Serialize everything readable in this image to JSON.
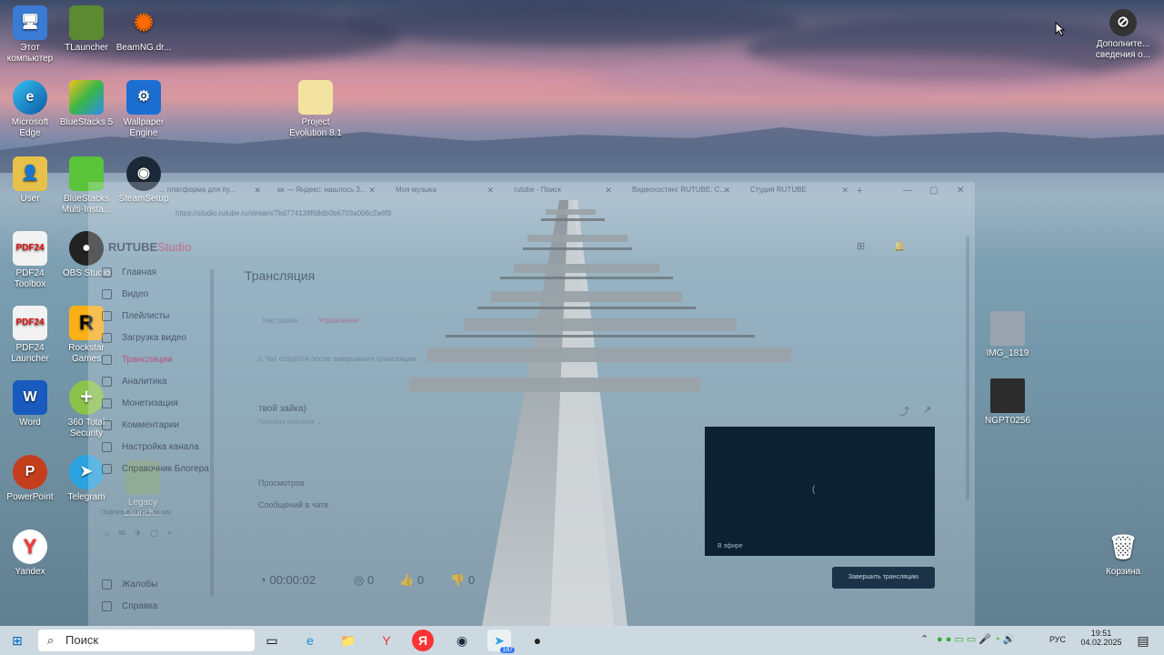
{
  "desktop": {
    "icons": [
      {
        "label": "Этот компьютер"
      },
      {
        "label": "TLauncher"
      },
      {
        "label": "BeamNG.dr..."
      },
      {
        "label": "Microsoft Edge"
      },
      {
        "label": "BlueStacks 5"
      },
      {
        "label": "Wallpaper Engine"
      },
      {
        "label": "Project Evolution 8.1"
      },
      {
        "label": "User"
      },
      {
        "label": "BlueStacks Multi-Insta..."
      },
      {
        "label": "SteamSetup"
      },
      {
        "label": "PDF24 Toolbox"
      },
      {
        "label": "OBS Studio"
      },
      {
        "label": "PDF24 Launcher"
      },
      {
        "label": "Rockstar Games"
      },
      {
        "label": "Word"
      },
      {
        "label": "360 Total Security"
      },
      {
        "label": "PowerPoint"
      },
      {
        "label": "Telegram"
      },
      {
        "label": "Legacy Launch..."
      },
      {
        "label": "Yandex"
      },
      {
        "label": "IMG_1819"
      },
      {
        "label": "NGPT0256"
      },
      {
        "label": "Корзина"
      },
      {
        "label": "Дополните... сведения о..."
      }
    ]
  },
  "browser": {
    "tabs": [
      {
        "label": "... платформа для пу..."
      },
      {
        "label": "вк — Яндекс: нашлось 3..."
      },
      {
        "label": "Моя музыка"
      },
      {
        "label": "rutube - Поиск"
      },
      {
        "label": "Видеохостинг RUTUBE. С..."
      },
      {
        "label": "Студия RUTUBE"
      }
    ],
    "new_tab": "+",
    "url": "https://studio.rutube.ru/stream/7bd774138f68db0b6703a006c2a6f9",
    "window_controls": {
      "minimize": "—",
      "maximize": "▢",
      "close": "✕"
    }
  },
  "studio": {
    "logo_main": "RUTUBE",
    "logo_sub": "Studio",
    "sidebar": [
      {
        "label": "Главная"
      },
      {
        "label": "Видео"
      },
      {
        "label": "Плейлисты"
      },
      {
        "label": "Загрузка видео"
      },
      {
        "label": "Трансляции"
      },
      {
        "label": "Аналитика"
      },
      {
        "label": "Монетизация"
      },
      {
        "label": "Комментарии"
      },
      {
        "label": "Настройка канала"
      },
      {
        "label": "Справочник Блогера"
      }
    ],
    "subscribe_text": "Подписывайтесь на нас",
    "footer_links": [
      {
        "label": "Жалобы"
      },
      {
        "label": "Справка"
      }
    ],
    "page_title": "Трансляция",
    "tabs": [
      {
        "label": "Настройки"
      },
      {
        "label": "Управление"
      }
    ],
    "notice": "Чат сотрётся после завершения трансляции",
    "stream_title": "твой зайка)",
    "show_desc": "Показать описание ⌄",
    "stats_views": "Просмотров",
    "stats_chat": "Сообщений в чате",
    "timer": "00:00:02",
    "counters": {
      "viewers": "0",
      "likes": "0",
      "dislikes": "0"
    },
    "live_badge": "В эфире",
    "end_button": "Завершить трансляцию"
  },
  "taskbar": {
    "search_label": "Поиск",
    "telegram_badge": "187",
    "lang": "РУС",
    "time": "19:51",
    "date": "04.02.2025"
  }
}
